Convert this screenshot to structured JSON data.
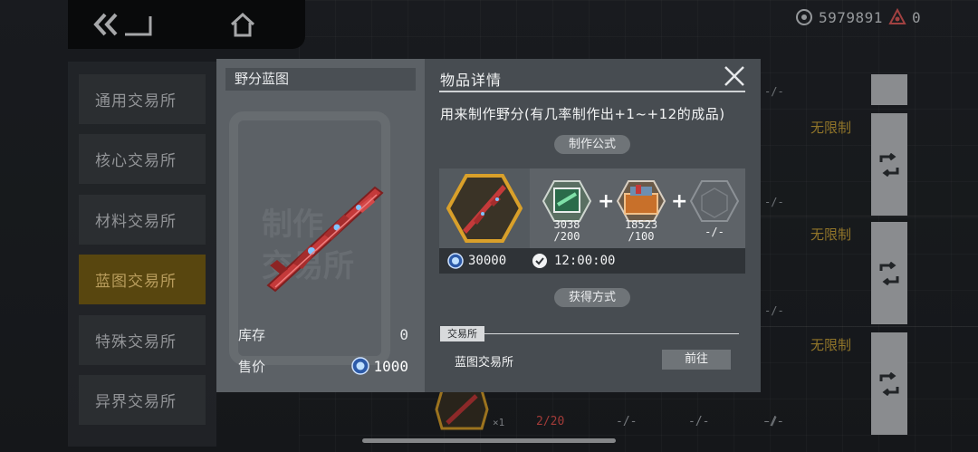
{
  "currency": {
    "coins": "5979891",
    "gems": "0",
    "coin_icon": "coin-icon",
    "gem_icon": "gem-icon"
  },
  "nav": {
    "back_icon": "double-chevron-back-icon",
    "home_icon": "home-icon"
  },
  "sidebar": {
    "items": [
      {
        "label": "通用交易所",
        "active": false
      },
      {
        "label": "核心交易所",
        "active": false
      },
      {
        "label": "材料交易所",
        "active": false
      },
      {
        "label": "蓝图交易所",
        "active": true
      },
      {
        "label": "特殊交易所",
        "active": false
      },
      {
        "label": "异界交易所",
        "active": false
      }
    ]
  },
  "background_rows": {
    "no_limit_label": "无限制",
    "dash": "-/-",
    "bottom_count": "2/20",
    "bottom_multiplier": "×1"
  },
  "modal": {
    "item_name": "野分蓝图",
    "watermark": "制作\n交易所",
    "stock_label": "库存",
    "stock_value": "0",
    "price_label": "售价",
    "price_value": "1000",
    "detail_title": "物品详情",
    "description": "用来制作野分(有几率制作出+1~+12的成品)",
    "formula_label": "制作公式",
    "recipe": {
      "materials": [
        {
          "icon": "green-crate-icon",
          "count": "3038\n/200"
        },
        {
          "icon": "orange-toolbox-icon",
          "count": "18523\n/100"
        },
        {
          "icon": "empty-slot-icon",
          "count": "-/-"
        }
      ],
      "cost": "30000",
      "time": "12:00:00"
    },
    "obtain_label": "获得方式",
    "source_tag": "交易所",
    "source_name": "蓝图交易所",
    "goto_label": "前往"
  },
  "colors": {
    "accent_gold": "#c9a23a",
    "active_tab": "#7a6216",
    "weapon_red": "#c43a3a",
    "hex_gold": "#d9a02a"
  }
}
